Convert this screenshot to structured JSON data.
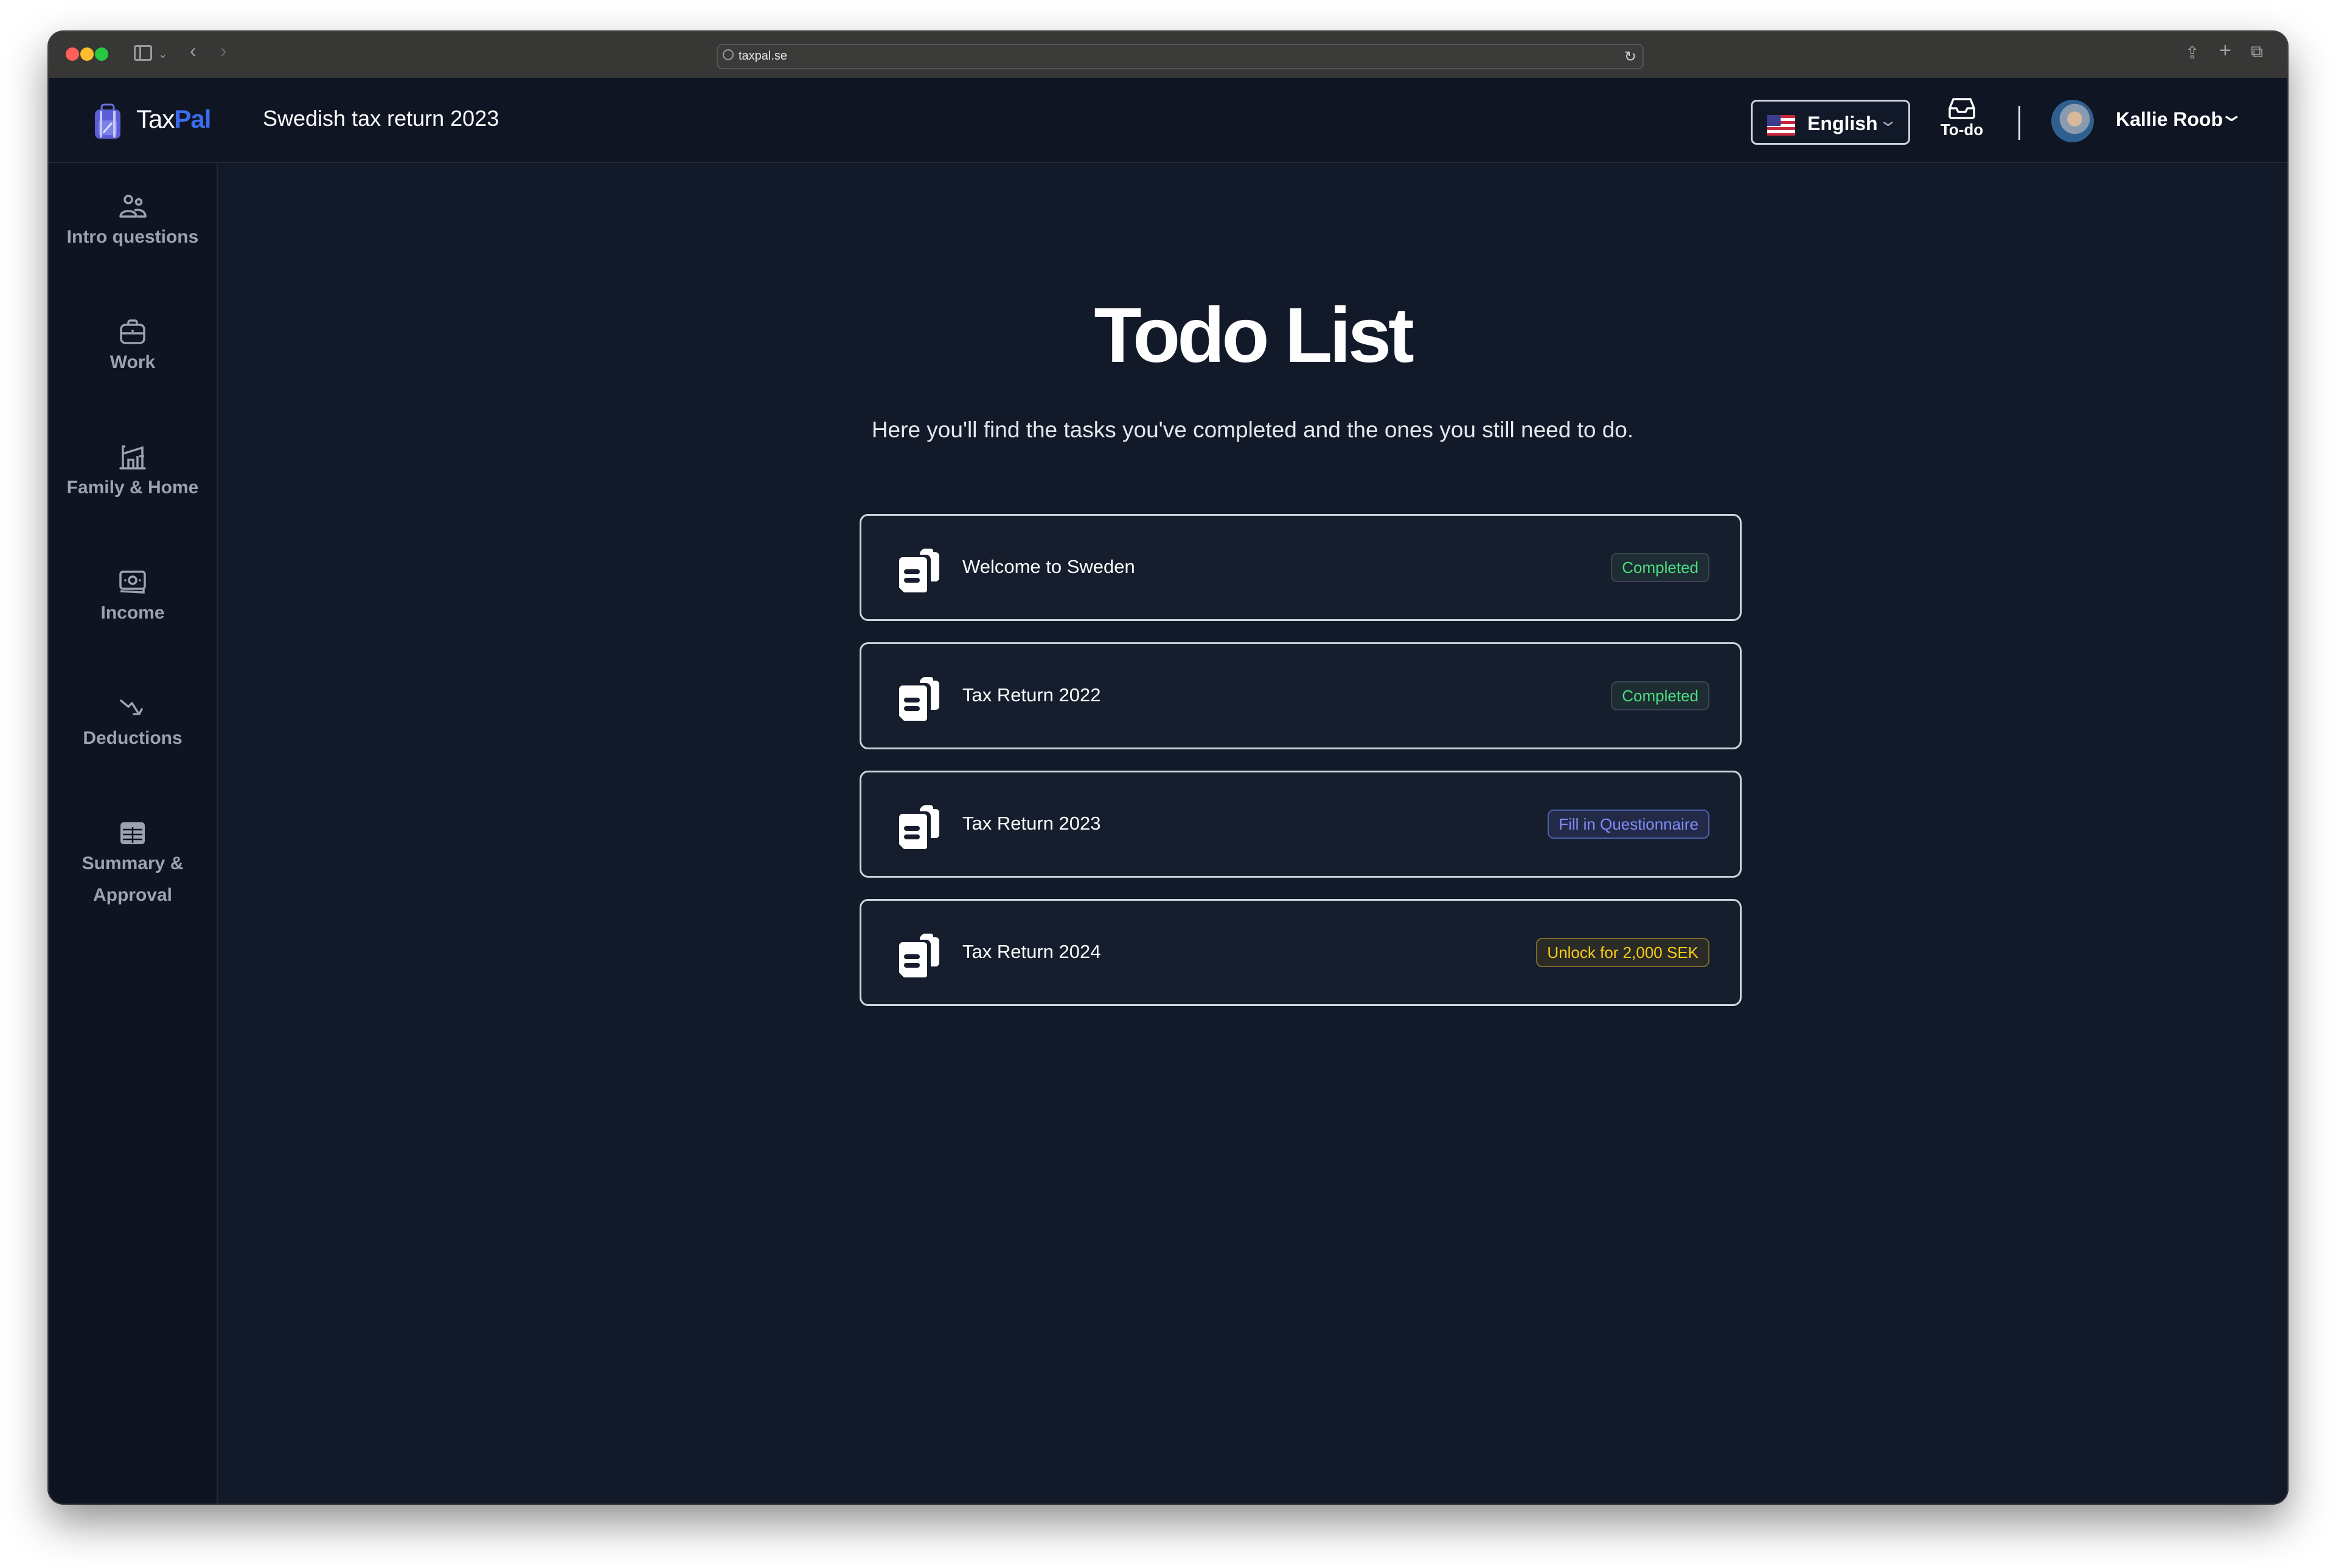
{
  "browser": {
    "url": "taxpal.se"
  },
  "header": {
    "brand_prefix": "Tax",
    "brand_suffix": "Pal",
    "title": "Swedish tax return 2023",
    "language": "English",
    "todo_label": "To-do",
    "user_name": "Kallie Roob"
  },
  "sidebar": {
    "items": [
      {
        "label": "Intro questions",
        "icon": "users-icon"
      },
      {
        "label": "Work",
        "icon": "briefcase-icon"
      },
      {
        "label": "Family & Home",
        "icon": "home-icon"
      },
      {
        "label": "Income",
        "icon": "banknotes-icon"
      },
      {
        "label": "Deductions",
        "icon": "trending-down-icon"
      },
      {
        "label": "Summary &",
        "label2": "Approval",
        "icon": "table-icon"
      }
    ]
  },
  "main": {
    "title": "Todo List",
    "subtitle": "Here you'll find the tasks you've completed and the ones you still need to do.",
    "tasks": [
      {
        "title": "Welcome to Sweden",
        "status": "Completed",
        "status_type": "completed",
        "color": "#4ade80"
      },
      {
        "title": "Tax Return 2022",
        "status": "Completed",
        "status_type": "completed",
        "color": "#4ade80"
      },
      {
        "title": "Tax Return 2023",
        "status": "Fill in Questionnaire",
        "status_type": "action",
        "color": "#818cf8"
      },
      {
        "title": "Tax Return 2024",
        "status": "Unlock for 2,000 SEK",
        "status_type": "locked",
        "color": "#facc15"
      }
    ]
  },
  "colors": {
    "background": "#111827",
    "brand_accent": "#3b6df0"
  }
}
